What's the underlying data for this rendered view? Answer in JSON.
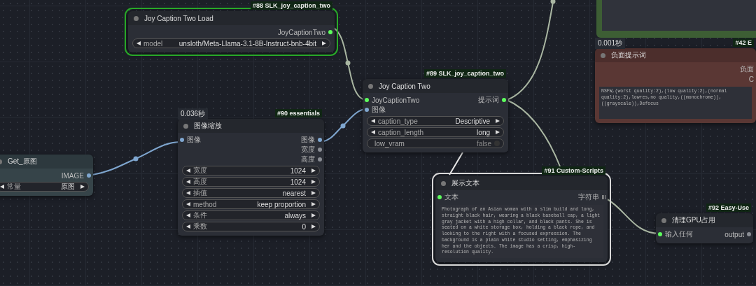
{
  "nodes": [
    {
      "kind": "node",
      "title": "Joy Caption Two Load",
      "badge": "#88 SLK_joy_caption_two",
      "color": "#2b2e36",
      "running": true,
      "selected": false,
      "outputs": [
        {
          "label": "JoyCaptionTwo",
          "kind": "dot",
          "color": "#5dfc5d"
        }
      ],
      "widgets": [
        {
          "kind": "combo",
          "label": "model",
          "value": "unsloth/Meta-Llama-3.1-8B-Instruct-bnb-4bit"
        }
      ]
    },
    {
      "kind": "frame",
      "color": "#3d5e34",
      "running": false,
      "selected": false
    },
    {
      "kind": "node",
      "title": "负面提示词",
      "timing": "0.001秒",
      "badge": "#42 E",
      "color": "#5a3734",
      "running": false,
      "selected": false,
      "outputs": [
        {
          "label": "负面",
          "kind": "none"
        },
        {
          "label": "C",
          "kind": "none"
        }
      ],
      "text": "NSFW,(worst quality:2),(low quality:2),(normal quality:2),lowres,no quality,((monochrome)),((grayscale)),Defocus"
    },
    {
      "kind": "node",
      "title": "Joy Caption Two",
      "badge": "#89 SLK_joy_caption_two",
      "color": "#2b2e36",
      "running": false,
      "selected": false,
      "inputs": [
        {
          "label": "JoyCaptionTwo",
          "kind": "dot",
          "color": "#5dfc5d"
        },
        {
          "label": "图像",
          "kind": "dot",
          "color": "#7fa6cf"
        }
      ],
      "outputs": [
        {
          "label": "提示词",
          "kind": "dot",
          "color": "#5dfc5d"
        }
      ],
      "widgets": [
        {
          "kind": "combo",
          "label": "caption_type",
          "value": "Descriptive"
        },
        {
          "kind": "combo",
          "label": "caption_length",
          "value": "long"
        },
        {
          "kind": "toggle",
          "label": "low_vram",
          "value": "false",
          "on": false
        }
      ]
    },
    {
      "kind": "node",
      "title": "图像缩放",
      "timing": "0.036秒",
      "badge": "#90 essentials",
      "color": "#2b2e36",
      "running": false,
      "selected": false,
      "inputs": [
        {
          "label": "图像",
          "kind": "dot",
          "color": "#7fa6cf"
        }
      ],
      "outputs": [
        {
          "label": "图像",
          "kind": "dot",
          "color": "#7fa6cf"
        },
        {
          "label": "宽度",
          "kind": "dot",
          "color": "#8a8d94"
        },
        {
          "label": "高度",
          "kind": "dot",
          "color": "#8a8d94"
        }
      ],
      "widgets": [
        {
          "kind": "combo",
          "label": "宽度",
          "value": "1024"
        },
        {
          "kind": "combo",
          "label": "高度",
          "value": "1024"
        },
        {
          "kind": "combo",
          "label": "插值",
          "value": "nearest"
        },
        {
          "kind": "combo",
          "label": "method",
          "value": "keep proportion"
        },
        {
          "kind": "combo",
          "label": "条件",
          "value": "always"
        },
        {
          "kind": "combo",
          "label": "乘数",
          "value": "0"
        }
      ]
    },
    {
      "kind": "node",
      "title": "Get_原图",
      "color": "#364449",
      "running": false,
      "selected": false,
      "outputs": [
        {
          "label": "IMAGE",
          "kind": "dot",
          "color": "#7fa6cf"
        }
      ],
      "widgets": [
        {
          "kind": "combo",
          "label": "常量",
          "value": "原图"
        }
      ]
    },
    {
      "kind": "node",
      "title": "展示文本",
      "badge": "#91 Custom-Scripts",
      "color": "#2b2e36",
      "running": false,
      "selected": true,
      "inputs": [
        {
          "label": "文本",
          "kind": "dot",
          "color": "#5dfc5d"
        }
      ],
      "outputs": [
        {
          "label": "字符串",
          "kind": "list"
        }
      ],
      "text": "Photograph of an Asian woman with a slim build and long, straight black hair, wearing a black baseball cap, a light gray jacket with a high collar, and black pants. She is seated on a white storage box, holding a black rope, and looking to the right with a focused expression. The background is a plain white studio setting, emphasizing her and the objects. The image has a crisp, high-resolution quality."
    },
    {
      "kind": "node",
      "title": "清理GPU占用",
      "badge": "#92 Easy-Use",
      "color": "#2b2e36",
      "running": false,
      "selected": false,
      "inputs": [
        {
          "label": "输入任何",
          "kind": "dot",
          "color": "#5dfc5d"
        }
      ],
      "outputs": [
        {
          "label": "output",
          "kind": "dot",
          "color": "#8a8d94"
        }
      ]
    }
  ]
}
